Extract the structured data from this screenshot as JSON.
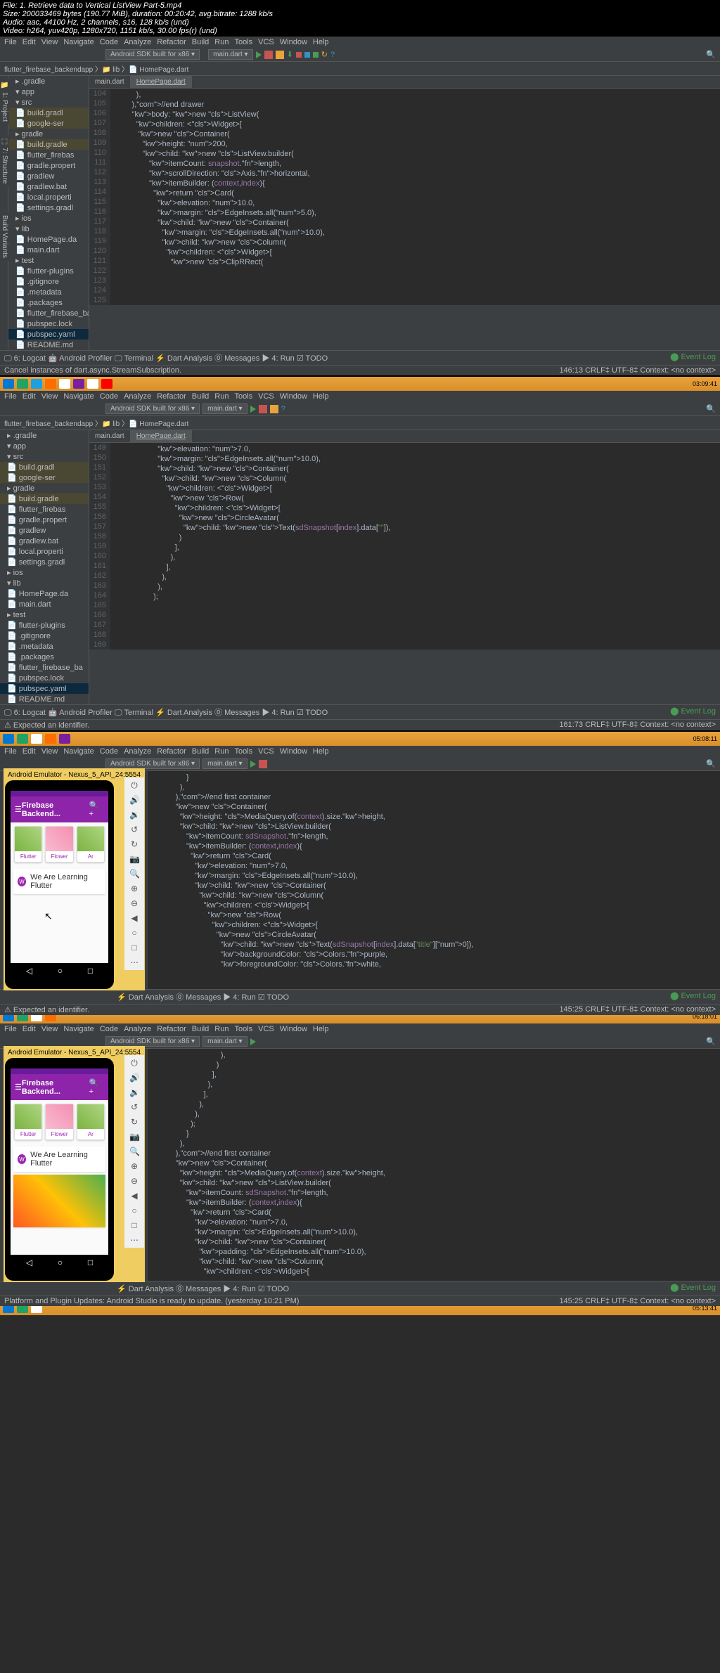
{
  "meta": {
    "file": "File: 1. Retrieve data to Vertical ListView Part-5.mp4",
    "size": "Size: 200033469 bytes (190.77 MiB), duration: 00:20:42, avg.bitrate: 1288 kb/s",
    "audio": "Audio: aac, 44100 Hz, 2 channels, s16, 128 kb/s (und)",
    "video": "Video: h264, yuv420p, 1280x720, 1151 kb/s, 30.00 fps(r) (und)"
  },
  "menu": [
    "File",
    "Edit",
    "View",
    "Navigate",
    "Code",
    "Analyze",
    "Refactor",
    "Build",
    "Run",
    "Tools",
    "VCS",
    "Window",
    "Help"
  ],
  "sdk": "Android SDK built for x86 ▾",
  "run_config": "main.dart ▾",
  "breadcrumb": "flutter_firebase_backendapp 〉📁 lib 〉📄 HomePage.dart",
  "tabs": {
    "main": "main.dart",
    "home": "HomePage.dart"
  },
  "tree": [
    {
      "t": "▸ .gradle",
      "c": ""
    },
    {
      "t": "▾ app",
      "c": ""
    },
    {
      "t": "  ▾ src",
      "c": ""
    },
    {
      "t": "    📄 build.gradl",
      "c": "yellow"
    },
    {
      "t": "    📄 google-ser",
      "c": "yellow"
    },
    {
      "t": "▸ gradle",
      "c": ""
    },
    {
      "t": "📄 build.gradle",
      "c": "yellow"
    },
    {
      "t": "📄 flutter_firebas",
      "c": ""
    },
    {
      "t": "📄 gradle.propert",
      "c": ""
    },
    {
      "t": "📄 gradlew",
      "c": ""
    },
    {
      "t": "📄 gradlew.bat",
      "c": ""
    },
    {
      "t": "📄 local.properti",
      "c": ""
    },
    {
      "t": "📄 settings.gradl",
      "c": ""
    },
    {
      "t": "▸ ios",
      "c": ""
    },
    {
      "t": "▾ lib",
      "c": ""
    },
    {
      "t": "  📄 HomePage.da",
      "c": ""
    },
    {
      "t": "  📄 main.dart",
      "c": ""
    },
    {
      "t": "▸ test",
      "c": ""
    },
    {
      "t": "📄 flutter-plugins",
      "c": ""
    },
    {
      "t": "📄 .gitignore",
      "c": ""
    },
    {
      "t": "📄 .metadata",
      "c": ""
    },
    {
      "t": "📄 .packages",
      "c": ""
    },
    {
      "t": "📄 flutter_firebase_ba",
      "c": ""
    },
    {
      "t": "📄 pubspec.lock",
      "c": ""
    },
    {
      "t": "📄 pubspec.yaml",
      "c": "sel"
    },
    {
      "t": "📄 README.md",
      "c": ""
    }
  ],
  "code1_start": 104,
  "code1": [
    "            ),",
    "          ),//end drawer",
    "          body: new ListView(",
    "            children: <Widget>[",
    "",
    "",
    "             new Container(",
    "               height: 200,",
    "               child: new ListView.builder(",
    "                  itemCount: snapshot.length,",
    "                  scrollDirection: Axis.horizontal,",
    "                  itemBuilder: (context,index){",
    "                    return Card(",
    "                      elevation: 10.0,",
    "                      margin: EdgeInsets.all(5.0),",
    "                      child: new Container(",
    "                        margin: EdgeInsets.all(10.0),",
    "                        child: new Column(",
    "                          children: <Widget>[",
    "",
    "",
    "                            new ClipRRect("
  ],
  "bottom_tabs": "🖵 6: Logcat   🤖 Android Profiler   🖵 Terminal   ⚡ Dart Analysis   ⓪ Messages   ▶ 4: Run   ☑ TODO",
  "status1": {
    "left": "Cancel instances of dart.async.StreamSubscription.",
    "right": "146:13   CRLF‡   UTF-8‡   Context: <no context>"
  },
  "event_log": "⬤ Event Log",
  "code2_start": 149,
  "code2": [
    "                      elevation: 7.0,",
    "                      margin: EdgeInsets.all(10.0),",
    "                      child: new Container(",
    "                        child: new Column(",
    "                          children: <Widget>[",
    "",
    "                            new Row(",
    "                              children: <Widget>[",
    "",
    "                                new CircleAvatar(",
    "                                  child: new Text(sdSnapshot[index].data[\"\"]),",
    "                                )",
    "",
    "                              ],",
    "                            ),",
    "",
    "",
    "                          ],",
    "                        ),",
    "                      ),",
    "                    );"
  ],
  "status2": {
    "left": "⚠ Expected an identifier.",
    "right": "161:73   CRLF‡   UTF-8‡   Context: <no context>"
  },
  "emulator_title": "Android Emulator - Nexus_5_API_24:5554",
  "app_title": "Firebase Backend...",
  "card_labels": [
    "Flutter",
    "Flower",
    "Ar"
  ],
  "list_text": "We Are Learning Flutter",
  "avatar_letter": "W",
  "code3": [
    "                  }",
    "               ),",
    "             ),//end first container",
    "",
    "             new Container(",
    "               height: MediaQuery.of(context).size.height,",
    "               child: new ListView.builder(",
    "                  itemCount: sdSnapshot.length,",
    "                  itemBuilder: (context,index){",
    "                    return Card(",
    "                      elevation: 7.0,",
    "                      margin: EdgeInsets.all(10.0),",
    "                      child: new Container(",
    "                        child: new Column(",
    "                          children: <Widget>[",
    "",
    "                            new Row(",
    "                              children: <Widget>[",
    "",
    "                                new CircleAvatar(",
    "                                  child: new Text(sdSnapshot[index].data[\"title\"][0]),",
    "                                  backgroundColor: Colors.purple,",
    "                                  foregroundColor: Colors.white,"
  ],
  "status3": {
    "left": "⚠ Expected an identifier.",
    "right": "145:25   CRLF‡   UTF-8‡   Context: <no context>"
  },
  "code4": [
    "                                  ),",
    "                                )",
    "",
    "                              ],",
    "                            ),",
    "",
    "",
    "                          ],",
    "                        ),",
    "                      ),",
    "                    );",
    "                  }",
    "               ),",
    "             ),//end first container",
    "",
    "             new Container(",
    "               height: MediaQuery.of(context).size.height,",
    "               child: new ListView.builder(",
    "                  itemCount: sdSnapshot.length,",
    "                  itemBuilder: (context,index){",
    "                    return Card(",
    "                      elevation: 7.0,",
    "                      margin: EdgeInsets.all(10.0),",
    "                      child: new Container(",
    "                        padding: EdgeInsets.all(10.0),",
    "                        child: new Column(",
    "                          children: <Widget>["
  ],
  "status4": {
    "left": "Platform and Plugin Updates: Android Studio is ready to update. (yesterday 10:21 PM)",
    "right": "145:25   CRLF‡   UTF-8‡   Context: <no context>"
  },
  "timestamps": [
    "03:09:41",
    "05:08:11",
    "06:18:01",
    "05:13:41"
  ],
  "emu_icons": [
    "⏻",
    "🔊",
    "🔉",
    "↺",
    "↻",
    "📷",
    "🔍",
    "⊕",
    "⊖",
    "◀",
    "○",
    "□",
    "⋯"
  ]
}
